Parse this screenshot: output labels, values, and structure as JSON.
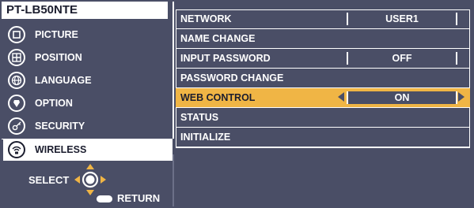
{
  "model": "PT-LB50NTE",
  "left_menu": {
    "items": [
      {
        "label": "PICTURE",
        "icon": "picture-icon"
      },
      {
        "label": "POSITION",
        "icon": "position-icon"
      },
      {
        "label": "LANGUAGE",
        "icon": "language-icon"
      },
      {
        "label": "OPTION",
        "icon": "option-icon"
      },
      {
        "label": "SECURITY",
        "icon": "security-icon"
      },
      {
        "label": "WIRELESS",
        "icon": "wireless-icon"
      }
    ],
    "active_index": 5
  },
  "nav": {
    "select_label": "SELECT",
    "return_label": "RETURN"
  },
  "right_menu": {
    "rows": [
      {
        "label": "NETWORK",
        "value": "USER1"
      },
      {
        "label": "NAME CHANGE",
        "value": ""
      },
      {
        "label": "INPUT PASSWORD",
        "value": "OFF"
      },
      {
        "label": "PASSWORD CHANGE",
        "value": ""
      },
      {
        "label": "WEB CONTROL",
        "value": "ON"
      },
      {
        "label": "STATUS",
        "value": ""
      },
      {
        "label": "INITIALIZE",
        "value": ""
      }
    ],
    "active_index": 4
  },
  "colors": {
    "background": "#4a4e66",
    "highlight": "#f0b545",
    "text": "#ffffff"
  }
}
